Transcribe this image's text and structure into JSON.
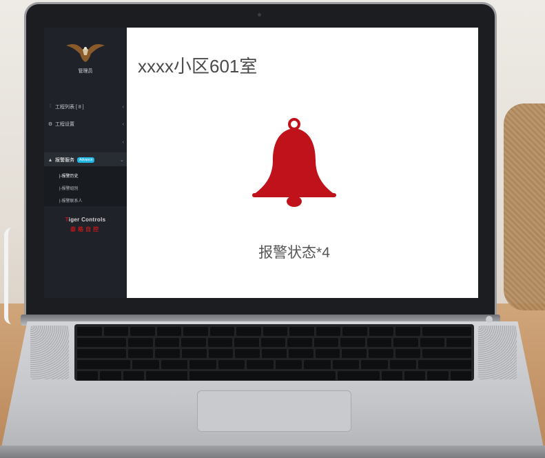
{
  "sidebar": {
    "user_label": "管理员",
    "items": [
      {
        "icon": "sitemap-icon",
        "label": "工程列表 [ 8 ]"
      },
      {
        "icon": "cogs-icon",
        "label": "工程设置"
      },
      {
        "icon": "",
        "label": ""
      },
      {
        "icon": "bell-icon",
        "label": "报警服务",
        "badge": "Advance"
      }
    ],
    "sub_items": [
      "|-报警历史",
      "|-报警组别",
      "|-报警联系人"
    ],
    "brand_en_first": "T",
    "brand_en_rest": "iger Controls",
    "brand_cn": "泰格自控"
  },
  "main": {
    "title": "xxxx小区601室",
    "status": "报警状态*4",
    "bell_icon": "bell-icon",
    "bell_color": "#c0121a"
  },
  "colors": {
    "sidebar_bg": "#1f2329",
    "badge": "#23b7e5",
    "accent_red": "#c0171b"
  }
}
